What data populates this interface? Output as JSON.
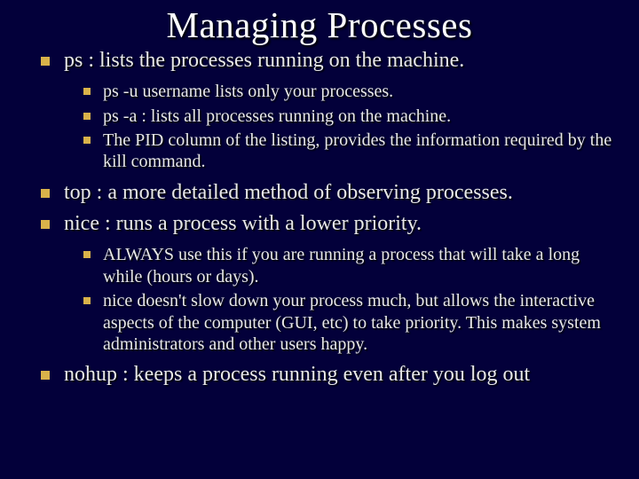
{
  "title": "Managing Processes",
  "items": [
    {
      "b": "ps",
      "rest": " : lists the processes running on the machine.",
      "sub": [
        {
          "text": " ps -u username lists only your processes."
        },
        {
          "text": "ps -a : lists all processes running on the machine."
        },
        {
          "text": "The PID column of the listing, provides the information required by the kill command."
        }
      ]
    },
    {
      "b": "top",
      "rest": " : a more detailed method of observing processes.",
      "sub": []
    },
    {
      "b": "nice",
      "rest": " : runs a process with a lower priority.",
      "sub": [
        {
          "text": "ALWAYS use this if you are running a process that will take a long while (hours or days)."
        },
        {
          "b": "nice",
          "rest": " doesn't slow down your process much, but allows the interactive aspects of the computer (GUI, etc) to take priority.  This makes system administrators and other users happy."
        }
      ]
    },
    {
      "b": "nohup",
      "rest": " : keeps a process running even after you log out",
      "sub": []
    }
  ]
}
